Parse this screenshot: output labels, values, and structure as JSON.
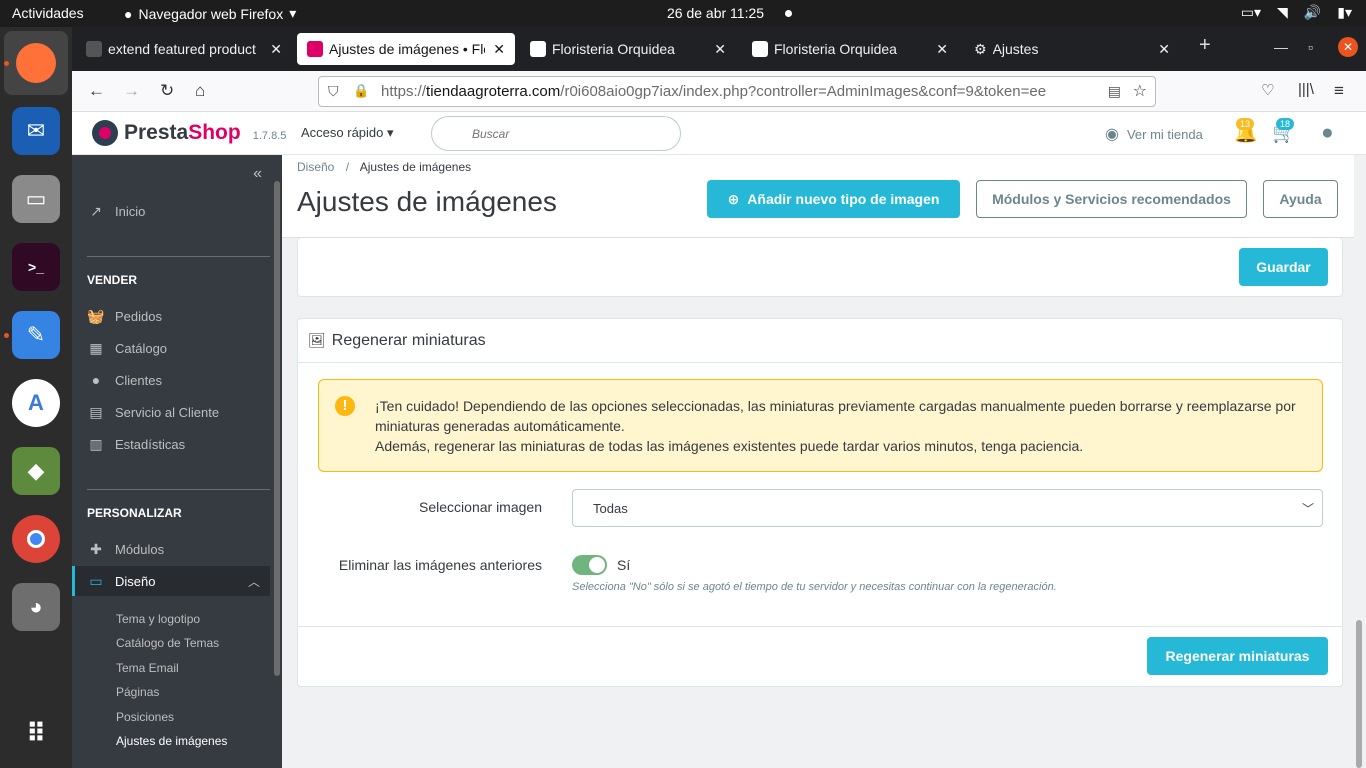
{
  "os": {
    "activities": "Actividades",
    "app_name": "Navegador web Firefox",
    "clock": "26 de abr  11:25"
  },
  "browser": {
    "tabs": [
      {
        "title": "extend featured product",
        "favicon_color": "#444444"
      },
      {
        "title": "Ajustes de imágenes • Flo",
        "favicon_color": "#df0067",
        "active": true
      },
      {
        "title": "Floristeria Orquidea",
        "favicon_color": "#ffffff"
      },
      {
        "title": "Floristeria Orquidea",
        "favicon_color": "#ffffff"
      },
      {
        "title": "Ajustes",
        "favicon_color": "#cccccc"
      }
    ],
    "url_prefix": "https://",
    "url_host": "tiendaagroterra.com",
    "url_path": "/r0i608aio0gp7iax/index.php?controller=AdminImages&conf=9&token=ee"
  },
  "header": {
    "brand_a": "Presta",
    "brand_b": "Shop",
    "version": "1.7.8.5",
    "quick_access": "Acceso rápido",
    "search_placeholder": "Buscar",
    "view_store": "Ver mi tienda",
    "notif_count": "13",
    "orders_count": "18"
  },
  "sidebar": {
    "home": "Inicio",
    "sell_title": "VENDER",
    "sell_items": [
      "Pedidos",
      "Catálogo",
      "Clientes",
      "Servicio al Cliente",
      "Estadísticas"
    ],
    "custom_title": "PERSONALIZAR",
    "modules": "Módulos",
    "design": "Diseño",
    "design_sub": [
      "Tema y logotipo",
      "Catálogo de Temas",
      "Tema Email",
      "Páginas",
      "Posiciones",
      "Ajustes de imágenes"
    ]
  },
  "page": {
    "breadcrumb_parent": "Diseño",
    "breadcrumb_current": "Ajustes de imágenes",
    "title": "Ajustes de imágenes",
    "add_button": "Añadir nuevo tipo de imagen",
    "modules_button": "Módulos y Servicios recomendados",
    "help_button": "Ayuda",
    "save_button": "Guardar"
  },
  "regen": {
    "title": "Regenerar miniaturas",
    "alert_line1": "¡Ten cuidado! Dependiendo de las opciones seleccionadas, las miniaturas previamente cargadas manualmente pueden borrarse y reemplazarse por miniaturas generadas automáticamente.",
    "alert_line2": "Además, regenerar las miniaturas de todas las imágenes existentes puede tardar varios minutos, tenga paciencia.",
    "select_label": "Seleccionar imagen",
    "select_value": "Todas",
    "erase_label": "Eliminar las imágenes anteriores",
    "erase_value": "Sí",
    "hint": "Selecciona \"No\" sólo si se agotó el tiempo de tu servidor y necesitas continuar con la regeneración.",
    "regen_button": "Regenerar miniaturas"
  },
  "colors": {
    "accent": "#25b9d7",
    "brand": "#df0067",
    "sidebar_bg": "#363a41",
    "alert_bg": "#fff5cf",
    "switch_on": "#70b580"
  }
}
